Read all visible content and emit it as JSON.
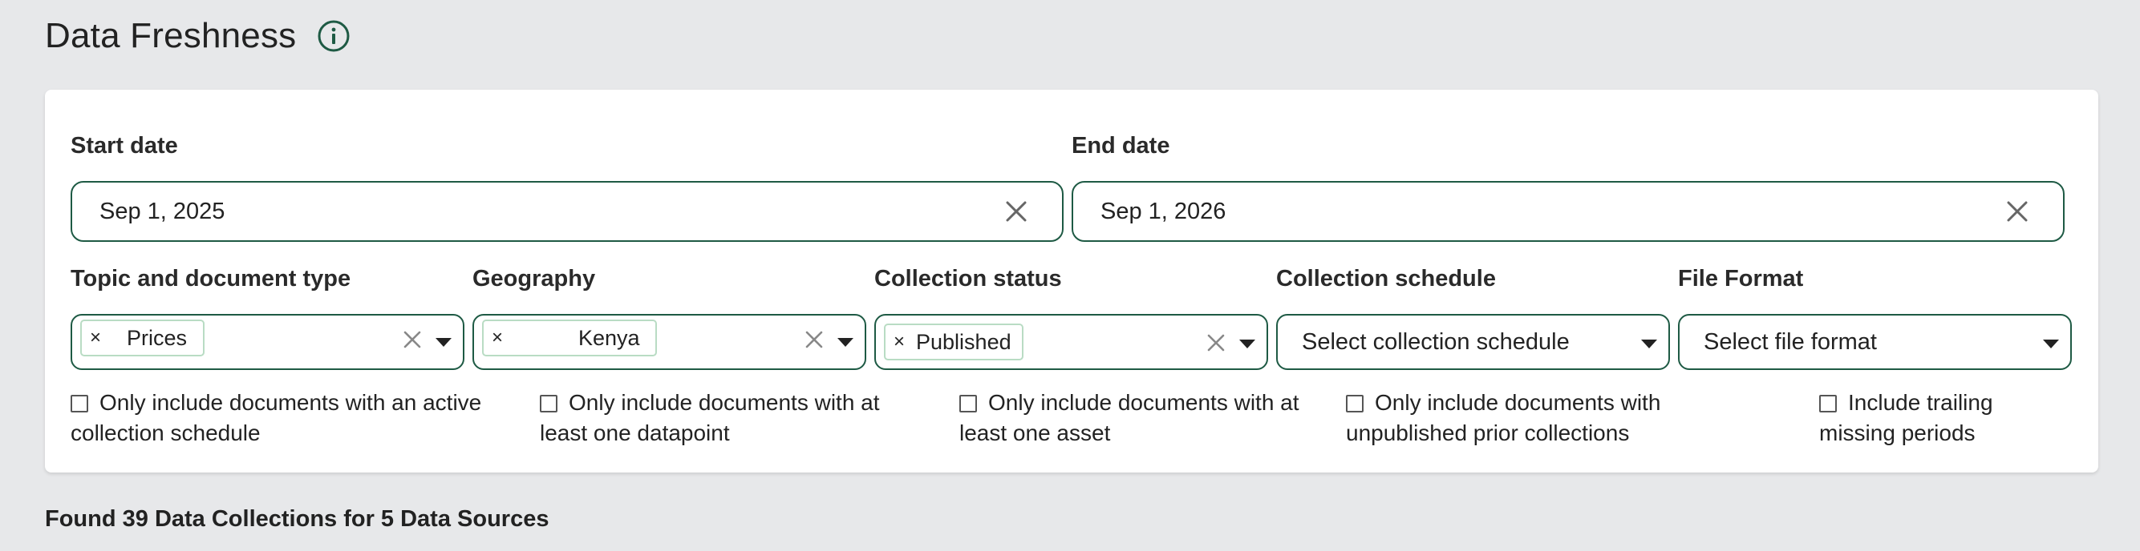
{
  "page": {
    "title": "Data Freshness",
    "info_icon": "info-icon"
  },
  "filters": {
    "start_date": {
      "label": "Start date",
      "value": "Sep 1, 2025"
    },
    "end_date": {
      "label": "End date",
      "value": "Sep 1, 2026"
    },
    "topic": {
      "label": "Topic and document type",
      "chip": "Prices"
    },
    "geography": {
      "label": "Geography",
      "chip": "Kenya"
    },
    "collection_status": {
      "label": "Collection status",
      "chip": "Published"
    },
    "collection_schedule": {
      "label": "Collection schedule",
      "placeholder": "Select collection schedule"
    },
    "file_format": {
      "label": "File Format",
      "placeholder": "Select file format"
    },
    "chip_remove": "×"
  },
  "checkboxes": {
    "active_schedule": {
      "line1": "Only include documents with an active",
      "line2": "collection schedule"
    },
    "datapoint": {
      "line1": "Only include documents with at",
      "line2": "least one datapoint"
    },
    "asset": {
      "line1": "Only include documents with at",
      "line2": "least one asset"
    },
    "unpublished_prior": {
      "line1": "Only include documents with",
      "line2": "unpublished prior collections"
    },
    "trailing_missing": {
      "line1": "Include trailing",
      "line2": "missing periods"
    }
  },
  "results": {
    "summary": "Found 39 Data Collections for 5 Data Sources"
  },
  "colors": {
    "accent": "#1e5a44",
    "chip_border": "#b9dcc4",
    "background": "#e7e8ea"
  }
}
